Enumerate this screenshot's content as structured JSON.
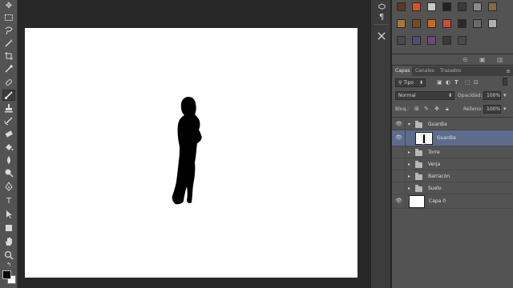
{
  "panel": {
    "tabs": [
      "Capas",
      "Canales",
      "Trazados"
    ],
    "filter_label": "Tipo",
    "blend_mode": "Normal",
    "opacity_label": "Opacidad:",
    "opacity_value": "100%",
    "lock_label": "Bloq.:",
    "fill_label": "Relleno:",
    "fill_value": "100%"
  },
  "layers": [
    {
      "name": "Guardia",
      "kind": "group",
      "expanded": true,
      "visible": true
    },
    {
      "name": "Guardia",
      "kind": "layer",
      "selected": true,
      "visible": true
    },
    {
      "name": "Torre",
      "kind": "group",
      "expanded": false,
      "visible": false
    },
    {
      "name": "Verja",
      "kind": "group",
      "expanded": false,
      "visible": false
    },
    {
      "name": "Barracón",
      "kind": "group",
      "expanded": false,
      "visible": false
    },
    {
      "name": "Suelo",
      "kind": "group",
      "expanded": false,
      "visible": false
    },
    {
      "name": "Capa 0",
      "kind": "layer",
      "selected": false,
      "visible": true
    }
  ],
  "styles_colors": [
    "#5a3a2a",
    "#e0501e",
    "#c8c8c8",
    "#222222",
    "#3a3a3a",
    "#8a8a8a",
    "#8a6a3a",
    "#a8783a",
    "#7a4a20",
    "#c86a20",
    "#d04a3a",
    "#2a2a2a",
    "#6a6a6a",
    "#b0b0b0",
    "#4a4a4a",
    "#4a5070",
    "#6a4a7a",
    "#3a3a3a",
    "#4a4a4a"
  ]
}
